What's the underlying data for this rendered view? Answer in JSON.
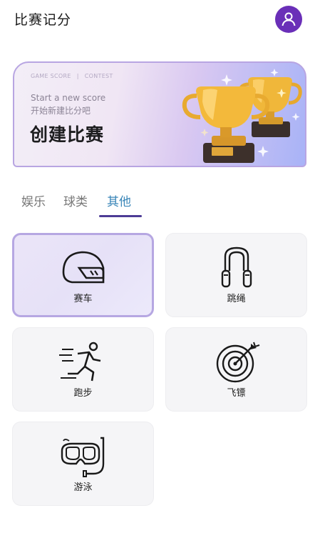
{
  "header": {
    "title": "比赛记分"
  },
  "banner": {
    "eyebrow_left": "GAME SCORE",
    "eyebrow_sep": "|",
    "eyebrow_right": "CONTEST",
    "subtitle_en": "Start a new score",
    "subtitle_cn": "开始新建比分吧",
    "headline": "创建比赛"
  },
  "tabs": [
    {
      "label": "娱乐",
      "active": false
    },
    {
      "label": "球类",
      "active": false
    },
    {
      "label": "其他",
      "active": true
    }
  ],
  "sports": [
    {
      "label": "赛车",
      "icon": "racing-helmet-icon",
      "selected": true
    },
    {
      "label": "跳绳",
      "icon": "jump-rope-icon",
      "selected": false
    },
    {
      "label": "跑步",
      "icon": "runner-icon",
      "selected": false
    },
    {
      "label": "飞镖",
      "icon": "dart-target-icon",
      "selected": false
    },
    {
      "label": "游泳",
      "icon": "swim-goggles-icon",
      "selected": false
    }
  ],
  "colors": {
    "accent": "#4d3c96",
    "active_tab": "#3a86b8",
    "avatar": "#6a2fb8",
    "selected_border": "#b6a7e2"
  }
}
